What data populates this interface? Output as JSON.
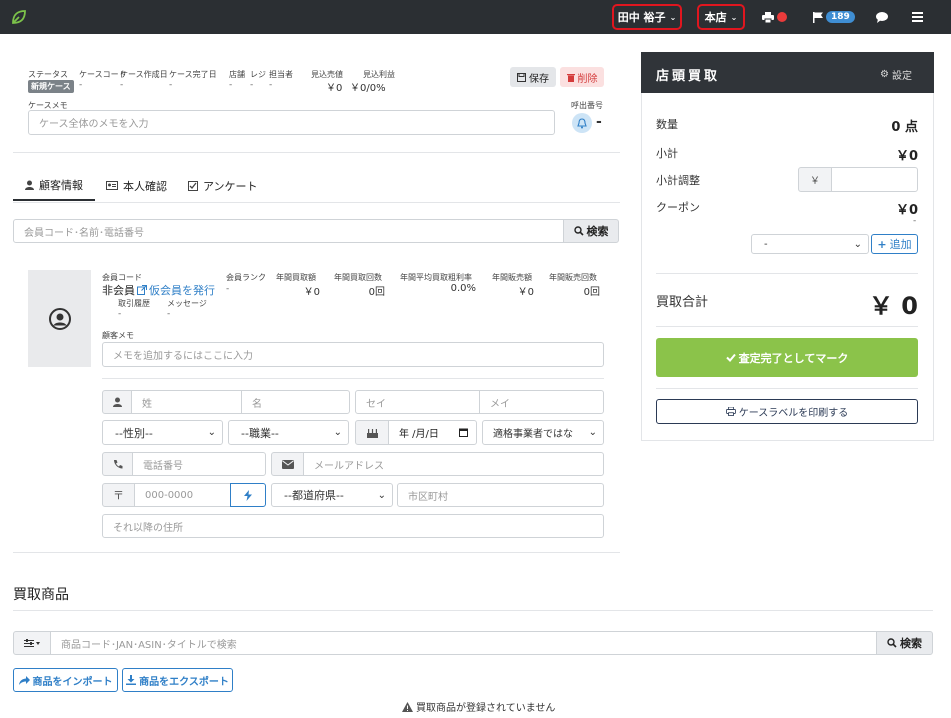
{
  "topbar": {
    "user": "田中 裕子",
    "store": "本店",
    "flag_count": "189"
  },
  "case": {
    "status_label": "ステータス",
    "status_badge": "新規ケース",
    "code_label": "ケースコード",
    "code_val": "-",
    "created_label": "ケース作成日",
    "created_val": "-",
    "completed_label": "ケース完了日",
    "completed_val": "-",
    "store_label": "店舗",
    "store_val": "-",
    "register_label": "レジ",
    "register_val": "-",
    "staff_label": "担当者",
    "staff_val": "-",
    "est_sales_label": "見込売値",
    "est_sales_val": "￥0",
    "est_profit_label": "見込利益",
    "est_profit_val": "￥0/0%",
    "save": "保存",
    "delete": "削除",
    "memo_label": "ケースメモ",
    "memo_placeholder": "ケース全体のメモを入力",
    "call_label": "呼出番号",
    "call_val": "-"
  },
  "tabs": {
    "customer": "顧客情報",
    "identity": "本人確認",
    "survey": "アンケート"
  },
  "search": {
    "placeholder": "会員コード･名前･電話番号",
    "button": "検索"
  },
  "member": {
    "code_label": "会員コード",
    "non_member": "非会員",
    "temp_link": "仮会員を発行",
    "history_label": "取引履歴",
    "history_val": "-",
    "message_label": "メッセージ",
    "message_val": "-",
    "rank_label": "会員ランク",
    "rank_val": "-",
    "annual_buy_label": "年間買取額",
    "annual_buy_val": "￥0",
    "annual_buy_count_label": "年間買取回数",
    "annual_buy_count_val": "0回",
    "avg_margin_label": "年間平均買取粗利率",
    "avg_margin_val": "0.0%",
    "annual_sales_label": "年間販売額",
    "annual_sales_val": "￥0",
    "annual_sales_count_label": "年間販売回数",
    "annual_sales_count_val": "0回",
    "memo_label": "顧客メモ",
    "memo_placeholder": "メモを追加するにはここに入力"
  },
  "form": {
    "last_name": "姓",
    "first_name": "名",
    "last_kana": "セイ",
    "first_kana": "メイ",
    "gender": "--性別--",
    "job": "--職業--",
    "date": "年 /月/日",
    "invoice": "適格事業者ではな",
    "phone": "電話番号",
    "email": "メールアドレス",
    "zip": "000-0000",
    "prefecture": "--都道府県--",
    "city": "市区町村",
    "address": "それ以降の住所"
  },
  "items": {
    "title": "買取商品",
    "search_placeholder": "商品コード･JAN･ASIN･タイトルで検索",
    "search_button": "検索",
    "import": "商品をインポート",
    "export": "商品をエクスポート",
    "empty": "買取商品が登録されていません"
  },
  "summary": {
    "title": "店頭買取",
    "settings": "設定",
    "qty_label": "数量",
    "qty_val": "0 点",
    "subtotal_label": "小計",
    "subtotal_val": "￥0",
    "adjust_label": "小計調整",
    "yen": "￥",
    "coupon_label": "クーポン",
    "coupon_val": "￥0",
    "coupon_sub": "-",
    "coupon_select": "-",
    "add": "追加",
    "total_label": "買取合計",
    "total_val": "￥ 0",
    "complete": "査定完了としてマーク",
    "print": "ケースラベルを印刷する"
  },
  "colors": {
    "topbar": "#2b2f33",
    "green": "#8bc34a",
    "accent_red": "#e0161f",
    "link": "#2f7fc7"
  }
}
